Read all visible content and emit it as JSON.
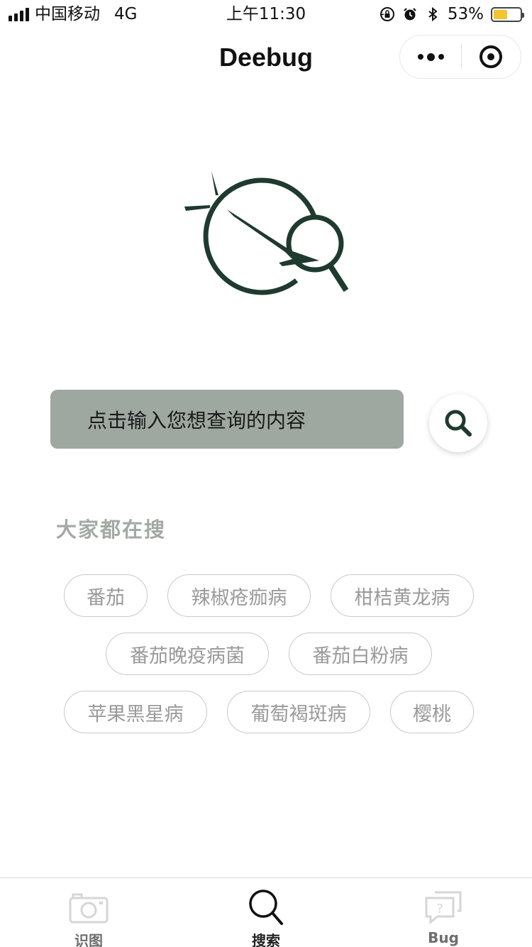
{
  "status_bar": {
    "carrier": "中国移动",
    "network": "4G",
    "time": "上午11:30",
    "battery_percent": "53%",
    "battery_level": 0.53,
    "icons": [
      "signal-icon",
      "rotation-lock-icon",
      "alarm-icon",
      "bluetooth-icon",
      "battery-icon"
    ]
  },
  "nav": {
    "title": "Deebug",
    "capsule_icons": [
      "more-icon",
      "close-target-icon"
    ]
  },
  "logo": {
    "icon": "deebug-logo-icon",
    "color": "#1f3a2e"
  },
  "search": {
    "placeholder": "点击输入您想查询的内容",
    "button_icon": "search-icon",
    "box_color": "#9ea8a0"
  },
  "hot_search": {
    "title": "大家都在搜",
    "tags": [
      "番茄",
      "辣椒疮痂病",
      "柑桔黄龙病",
      "番茄晚疫病菌",
      "番茄白粉病",
      "苹果黑星病",
      "葡萄褐斑病",
      "樱桃"
    ]
  },
  "tabbar": {
    "active_index": 1,
    "tabs": [
      {
        "label": "识图",
        "icon": "camera-icon"
      },
      {
        "label": "搜索",
        "icon": "search-icon"
      },
      {
        "label": "Bug",
        "icon": "question-chat-icon"
      }
    ]
  },
  "colors": {
    "accent": "#1f3a2e",
    "tag_text": "#9a9a9a",
    "section_title": "#a2aaa3"
  }
}
